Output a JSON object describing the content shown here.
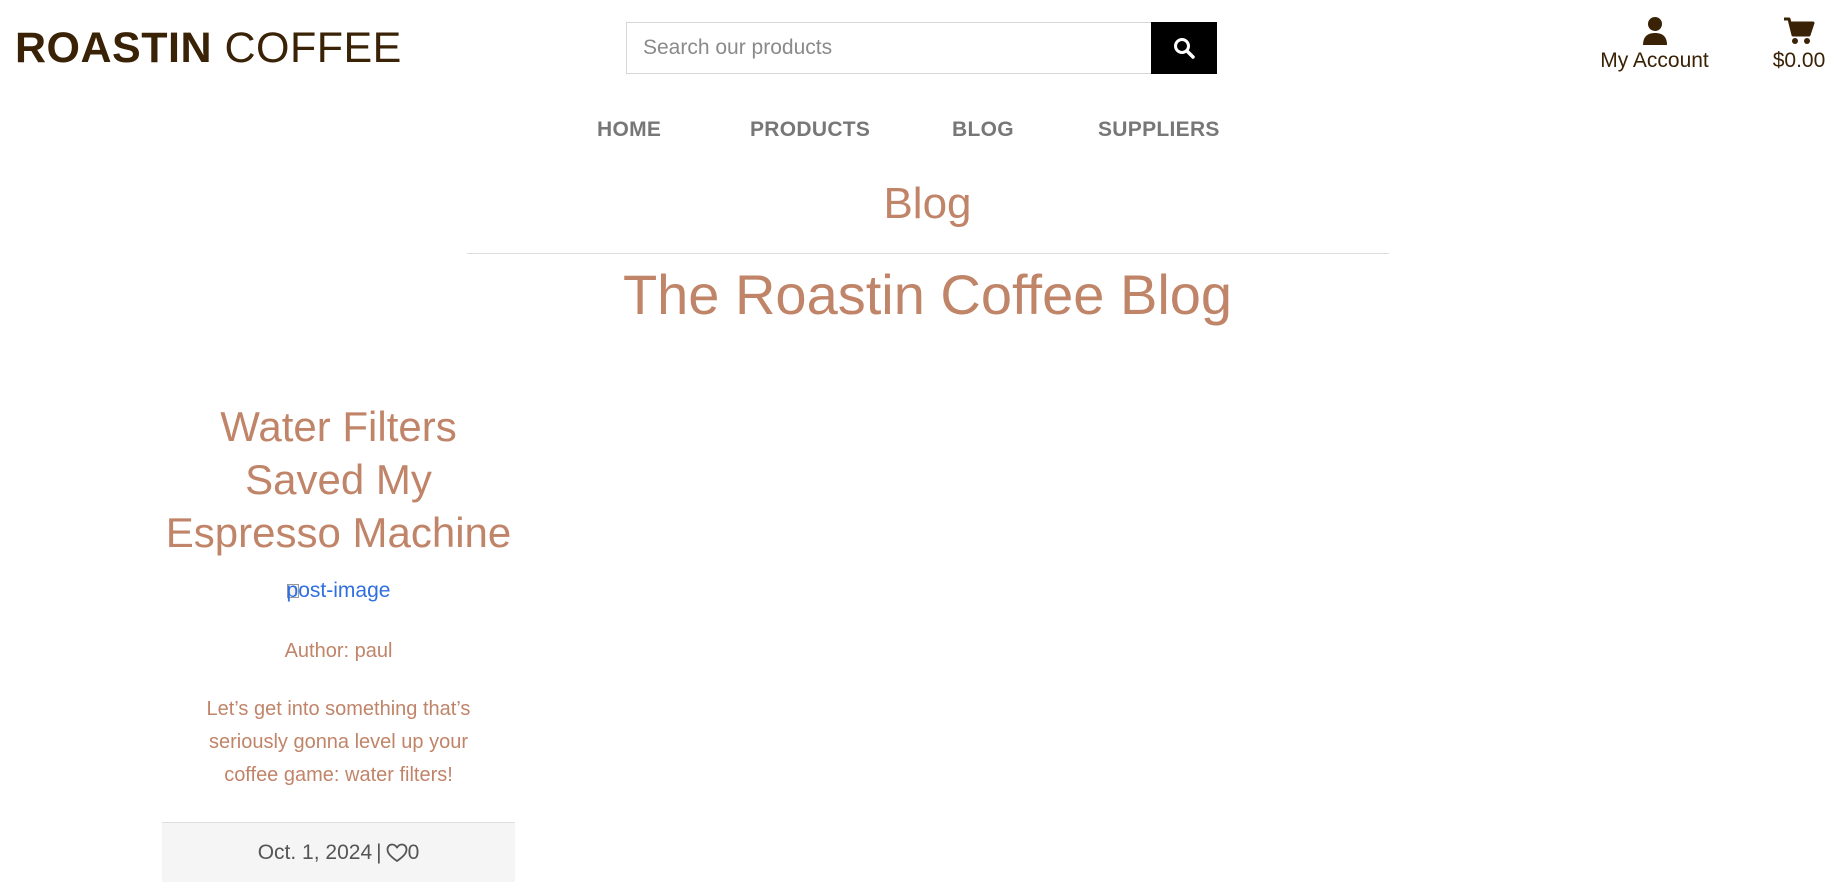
{
  "header": {
    "brand_bold": "ROASTIN",
    "brand_light": "COFFEE",
    "search_placeholder": "Search our products",
    "account_label": "My Account",
    "cart_total": "$0.00"
  },
  "nav": {
    "items": [
      {
        "label": "HOME"
      },
      {
        "label": "PRODUCTS"
      },
      {
        "label": "BLOG"
      },
      {
        "label": "SUPPLIERS"
      }
    ]
  },
  "page": {
    "section_label": "Blog",
    "title": "The Roastin Coffee Blog"
  },
  "posts": [
    {
      "title": "Water Filters Saved My Espresso Machine",
      "image_alt": "post-image",
      "author": "Author: paul",
      "excerpt": "Let’s get into something that’s seriously gonna level up your coffee game: water filters!",
      "date": "Oct. 1, 2024",
      "likes": "0"
    }
  ],
  "colors": {
    "brand": "#3a2206",
    "accent": "#c08469",
    "nav": "#777777",
    "link": "#2f6fe0"
  },
  "icons": {
    "search": "search-icon",
    "account": "user-icon",
    "cart": "cart-icon",
    "like": "heart-icon"
  }
}
